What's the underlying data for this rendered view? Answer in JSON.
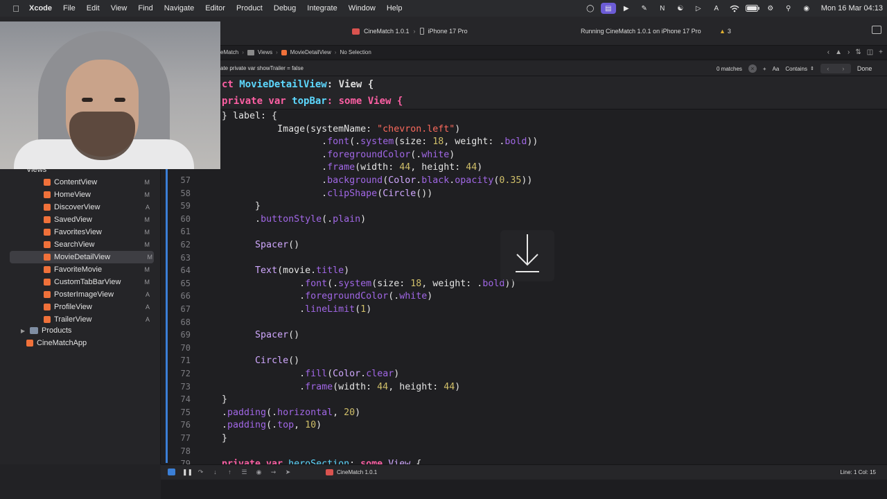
{
  "menubar": {
    "app_name": "Xcode",
    "items": [
      "File",
      "Edit",
      "View",
      "Find",
      "Navigate",
      "Editor",
      "Product",
      "Debug",
      "Integrate",
      "Window",
      "Help"
    ],
    "status_icons": [
      "creative-cloud-icon",
      "stage-manager-icon",
      "facetime-icon",
      "pen-icon",
      "notion-icon",
      "accessibility-icon",
      "play-icon",
      "a-icon",
      "wifi-icon",
      "battery-icon",
      "control-center-icon",
      "search-icon",
      "siri-icon"
    ],
    "datetime": "Mon 16 Mar  04:13"
  },
  "toolbar": {
    "scheme": "CineMatch 1.0.1",
    "destination": "iPhone 17 Pro",
    "status": "Running CineMatch 1.0.1 on iPhone 17 Pro",
    "warnings": "3"
  },
  "jumpbar": {
    "project": "eMatch",
    "group": "Views",
    "file": "MovieDetailView",
    "selection": "No Selection"
  },
  "findbar": {
    "query": "ate private var showTrailer = false",
    "matches": "0 matches",
    "case_label": "Aa",
    "mode": "Contains",
    "done_label": "Done"
  },
  "editor": {
    "sticky_1": {
      "kw": "ct",
      "name": "MovieDetailView",
      "rest": ": View {"
    },
    "sticky_2": {
      "kw": "private var",
      "name": "topBar",
      "rest": ": some View {"
    },
    "lines": [
      {
        "n": "",
        "code": [
          [
            "",
            "} label: {"
          ]
        ]
      },
      {
        "n": "",
        "code": [
          [
            "",
            "    Image(systemName: "
          ],
          [
            "str",
            "\"chevron.left\""
          ],
          [
            "",
            ")"
          ]
        ]
      },
      {
        "n": "",
        "code": [
          [
            "",
            "        ."
          ],
          [
            "fn",
            "font"
          ],
          [
            "",
            "(."
          ],
          [
            "fn",
            "system"
          ],
          [
            "",
            "(size: "
          ],
          [
            "num",
            "18"
          ],
          [
            "",
            ", weight: ."
          ],
          [
            "fn",
            "bold"
          ],
          [
            "",
            "))"
          ]
        ]
      },
      {
        "n": "",
        "code": [
          [
            "",
            "        ."
          ],
          [
            "fn",
            "foregroundColor"
          ],
          [
            "",
            "(."
          ],
          [
            "fn",
            "white"
          ],
          [
            "",
            ")"
          ]
        ]
      },
      {
        "n": "",
        "code": [
          [
            "",
            "        ."
          ],
          [
            "fn",
            "frame"
          ],
          [
            "",
            "(width: "
          ],
          [
            "num",
            "44"
          ],
          [
            "",
            ", height: "
          ],
          [
            "num",
            "44"
          ],
          [
            "",
            ")"
          ]
        ]
      },
      {
        "n": "57",
        "code": [
          [
            "",
            "        ."
          ],
          [
            "fn",
            "background"
          ],
          [
            "",
            "("
          ],
          [
            "type",
            "Color"
          ],
          [
            "",
            "."
          ],
          [
            "fn",
            "black"
          ],
          [
            "",
            "."
          ],
          [
            "fn",
            "opacity"
          ],
          [
            "",
            "("
          ],
          [
            "num",
            "0.35"
          ],
          [
            "",
            "))"
          ]
        ]
      },
      {
        "n": "58",
        "code": [
          [
            "",
            "        ."
          ],
          [
            "fn",
            "clipShape"
          ],
          [
            "",
            "("
          ],
          [
            "type",
            "Circle"
          ],
          [
            "",
            "())"
          ]
        ]
      },
      {
        "n": "59",
        "code": [
          [
            "",
            "  }"
          ]
        ]
      },
      {
        "n": "60",
        "code": [
          [
            "",
            "  ."
          ],
          [
            "fn",
            "buttonStyle"
          ],
          [
            "",
            "(."
          ],
          [
            "fn",
            "plain"
          ],
          [
            "",
            ")"
          ]
        ]
      },
      {
        "n": "61",
        "code": [
          [
            "",
            ""
          ]
        ]
      },
      {
        "n": "62",
        "code": [
          [
            "",
            "  "
          ],
          [
            "type",
            "Spacer"
          ],
          [
            "",
            "()"
          ]
        ]
      },
      {
        "n": "63",
        "code": [
          [
            "",
            ""
          ]
        ]
      },
      {
        "n": "64",
        "code": [
          [
            "",
            "  "
          ],
          [
            "type",
            "Text"
          ],
          [
            "",
            "(movie."
          ],
          [
            "fn",
            "title"
          ],
          [
            "",
            ")"
          ]
        ]
      },
      {
        "n": "65",
        "code": [
          [
            "",
            "      ."
          ],
          [
            "fn",
            "font"
          ],
          [
            "",
            "(."
          ],
          [
            "fn",
            "system"
          ],
          [
            "",
            "(size: "
          ],
          [
            "num",
            "18"
          ],
          [
            "",
            ", weight: ."
          ],
          [
            "fn",
            "bold"
          ],
          [
            "",
            "))"
          ]
        ]
      },
      {
        "n": "66",
        "code": [
          [
            "",
            "      ."
          ],
          [
            "fn",
            "foregroundColor"
          ],
          [
            "",
            "(."
          ],
          [
            "fn",
            "white"
          ],
          [
            "",
            ")"
          ]
        ]
      },
      {
        "n": "67",
        "code": [
          [
            "",
            "      ."
          ],
          [
            "fn",
            "lineLimit"
          ],
          [
            "",
            "("
          ],
          [
            "num",
            "1"
          ],
          [
            "",
            ")"
          ]
        ]
      },
      {
        "n": "68",
        "code": [
          [
            "",
            ""
          ]
        ]
      },
      {
        "n": "69",
        "code": [
          [
            "",
            "  "
          ],
          [
            "type",
            "Spacer"
          ],
          [
            "",
            "()"
          ]
        ]
      },
      {
        "n": "70",
        "code": [
          [
            "",
            ""
          ]
        ]
      },
      {
        "n": "71",
        "code": [
          [
            "",
            "  "
          ],
          [
            "type",
            "Circle"
          ],
          [
            "",
            "()"
          ]
        ]
      },
      {
        "n": "72",
        "code": [
          [
            "",
            "      ."
          ],
          [
            "fn",
            "fill"
          ],
          [
            "",
            "("
          ],
          [
            "type",
            "Color"
          ],
          [
            "",
            "."
          ],
          [
            "fn",
            "clear"
          ],
          [
            "",
            ")"
          ]
        ]
      },
      {
        "n": "73",
        "code": [
          [
            "",
            "      ."
          ],
          [
            "fn",
            "frame"
          ],
          [
            "",
            "(width: "
          ],
          [
            "num",
            "44"
          ],
          [
            "",
            ", height: "
          ],
          [
            "num",
            "44"
          ],
          [
            "",
            ")"
          ]
        ]
      },
      {
        "n": "74",
        "code": [
          [
            "",
            "}"
          ]
        ]
      },
      {
        "n": "75",
        "code": [
          [
            "",
            "."
          ],
          [
            "fn",
            "padding"
          ],
          [
            "",
            "(."
          ],
          [
            "fn",
            "horizontal"
          ],
          [
            "",
            ", "
          ],
          [
            "num",
            "20"
          ],
          [
            "",
            ")"
          ]
        ]
      },
      {
        "n": "76",
        "code": [
          [
            "",
            "."
          ],
          [
            "fn",
            "padding"
          ],
          [
            "",
            "(."
          ],
          [
            "fn",
            "top"
          ],
          [
            "",
            ", "
          ],
          [
            "num",
            "10"
          ],
          [
            "",
            ")"
          ]
        ]
      },
      {
        "n": "77",
        "code": [
          [
            "",
            "}"
          ]
        ]
      },
      {
        "n": "78",
        "code": [
          [
            "",
            ""
          ]
        ]
      },
      {
        "n": "79",
        "code": [
          [
            "kw",
            "private var "
          ],
          [
            "dec",
            "heroSection"
          ],
          [
            "",
            ": "
          ],
          [
            "kw",
            "some "
          ],
          [
            "type",
            "View"
          ],
          [
            "",
            " {"
          ]
        ]
      }
    ]
  },
  "sidebar": {
    "group_label": "Views",
    "items": [
      {
        "label": "ContentView",
        "badge": "M"
      },
      {
        "label": "HomeView",
        "badge": "M"
      },
      {
        "label": "DiscoverView",
        "badge": "A"
      },
      {
        "label": "SavedView",
        "badge": "M"
      },
      {
        "label": "FavoritesView",
        "badge": "M"
      },
      {
        "label": "SearchView",
        "badge": "M"
      },
      {
        "label": "MovieDetailView",
        "badge": "M",
        "selected": true
      },
      {
        "label": "FavoriteMovie",
        "badge": "M"
      },
      {
        "label": "CustomTabBarView",
        "badge": "M"
      },
      {
        "label": "PosterImageView",
        "badge": "A"
      },
      {
        "label": "ProfileView",
        "badge": "A"
      },
      {
        "label": "TrailerView",
        "badge": "A"
      }
    ],
    "products_label": "Products",
    "app_label": "CineMatchApp"
  },
  "debugbar": {
    "target": "CineMatch 1.0.1",
    "position": "Line: 1  Col: 15"
  },
  "colors": {
    "accent": "#3b7fd6",
    "keyword": "#fc5fa3",
    "string": "#fc6a5d",
    "number": "#d0bf69"
  }
}
